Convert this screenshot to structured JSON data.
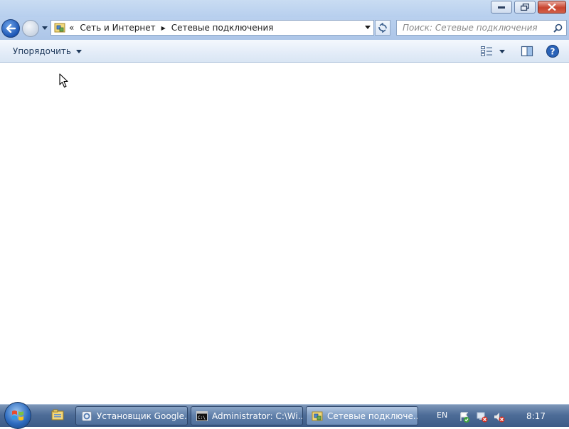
{
  "window": {
    "caption": {
      "minimize_icon": "minimize-icon",
      "maximize_icon": "restore-icon",
      "close_icon": "close-icon"
    }
  },
  "address_bar": {
    "overflow_chevron": "«",
    "breadcrumbs": [
      "Сеть и Интернет",
      "Сетевые подключения"
    ]
  },
  "search": {
    "placeholder": "Поиск: Сетевые подключения"
  },
  "command_bar": {
    "organize_label": "Упорядочить"
  },
  "taskbar": {
    "tasks": [
      {
        "label": "Установщик Google...",
        "icon": "installer-icon"
      },
      {
        "label": "Administrator: C:\\Wi...",
        "icon": "cmd-icon"
      },
      {
        "label": "Сетевые подключе...",
        "icon": "network-folder-icon",
        "active": true
      }
    ],
    "language": "EN",
    "clock": "8:17"
  },
  "colors": {
    "frame": "#b9d0ee",
    "taskbar": "#4e6d98",
    "content": "#ffffff"
  }
}
